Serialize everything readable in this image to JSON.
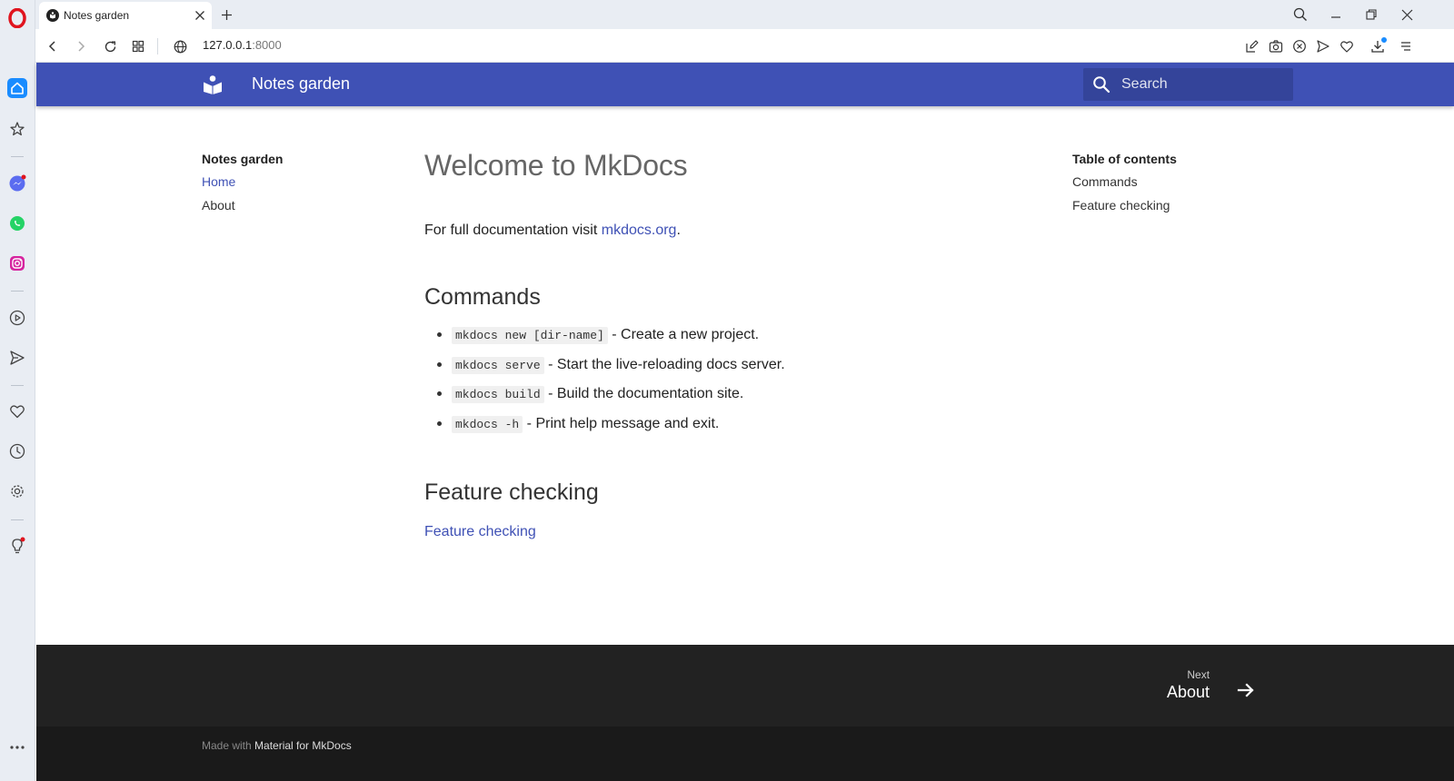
{
  "browser": {
    "tab_title": "Notes garden",
    "url_host": "127.0.0.1",
    "url_port": ":8000"
  },
  "colors": {
    "header_bg": "#3f51b5",
    "search_bg": "#34449a",
    "link": "#3f51b5",
    "footer_nav_bg": "#222222",
    "footer_meta_bg": "#1a1a1a"
  },
  "sidebar_icons": [
    "opera-logo-icon",
    "home-icon",
    "pinboard-icon",
    "messenger-icon",
    "whatsapp-icon",
    "instagram-icon",
    "player-icon",
    "send-icon",
    "heart-icon",
    "history-icon",
    "settings-icon",
    "lightbulb-icon",
    "more-icon"
  ],
  "header": {
    "site_name": "Notes garden",
    "search_placeholder": "Search"
  },
  "nav": {
    "heading": "Notes garden",
    "items": [
      {
        "label": "Home",
        "active": true
      },
      {
        "label": "About",
        "active": false
      }
    ]
  },
  "content": {
    "title": "Welcome to MkDocs",
    "intro_text": "For full documentation visit ",
    "intro_link": "mkdocs.org",
    "intro_end": ".",
    "commands_heading": "Commands",
    "commands": [
      {
        "code": "mkdocs new [dir-name]",
        "desc": " - Create a new project."
      },
      {
        "code": "mkdocs serve",
        "desc": " - Start the live-reloading docs server."
      },
      {
        "code": "mkdocs build",
        "desc": " - Build the documentation site."
      },
      {
        "code": "mkdocs -h",
        "desc": " - Print help message and exit."
      }
    ],
    "feature_heading": "Feature checking",
    "feature_link": "Feature checking"
  },
  "toc": {
    "heading": "Table of contents",
    "items": [
      "Commands",
      "Feature checking"
    ]
  },
  "footer": {
    "next_label": "Next",
    "next_title": "About",
    "made_with_prefix": "Made with ",
    "made_with_link": "Material for MkDocs"
  }
}
